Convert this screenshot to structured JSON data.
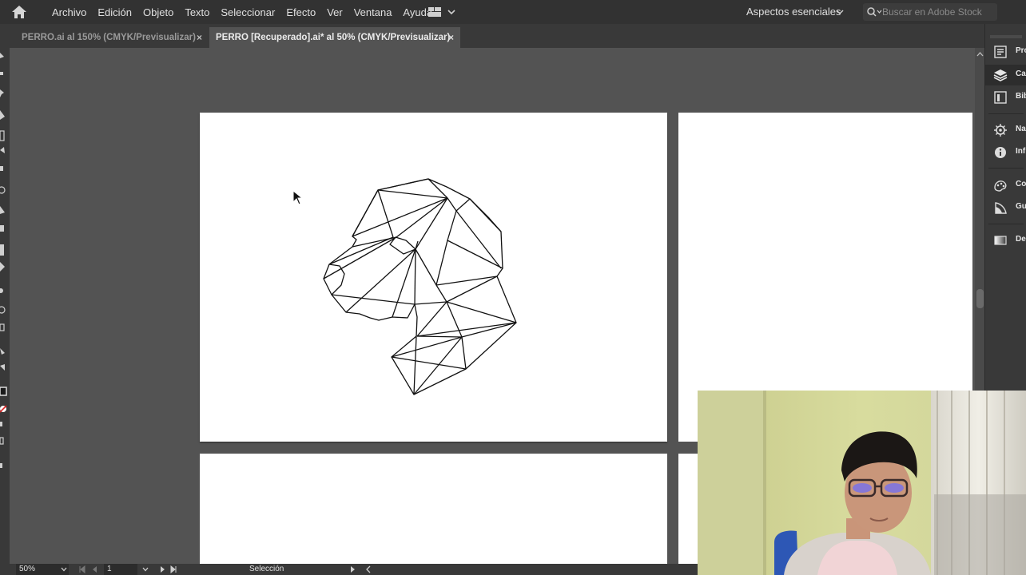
{
  "menubar": {
    "items": [
      "Archivo",
      "Edición",
      "Objeto",
      "Texto",
      "Seleccionar",
      "Efecto",
      "Ver",
      "Ventana",
      "Ayuda"
    ],
    "workspace": "Aspectos esenciales",
    "search_placeholder": "Buscar en Adobe Stock"
  },
  "tabs": [
    {
      "label": "PERRO.ai al 150% (CMYK/Previsualizar)",
      "close": "×",
      "active": false
    },
    {
      "label": "PERRO [Recuperado].ai* al 50% (CMYK/Previsualizar)",
      "close": "×",
      "active": true
    }
  ],
  "dock": {
    "items": [
      {
        "label": "Pro",
        "icon": "properties-icon"
      },
      {
        "label": "Ca",
        "icon": "layers-icon"
      },
      {
        "label": "Bib",
        "icon": "libraries-icon"
      },
      {
        "label": "Na",
        "icon": "navigator-icon"
      },
      {
        "label": "Inf",
        "icon": "info-icon"
      },
      {
        "label": "Co",
        "icon": "color-icon"
      },
      {
        "label": "Gu",
        "icon": "color-guide-icon"
      },
      {
        "label": "De",
        "icon": "gradient-icon"
      }
    ]
  },
  "statusbar": {
    "zoom": "50%",
    "page": "1",
    "tool": "Selección"
  },
  "colors": {
    "chrome": "#323232",
    "panel": "#393939",
    "canvas": "#535353",
    "artboard": "#ffffff"
  }
}
